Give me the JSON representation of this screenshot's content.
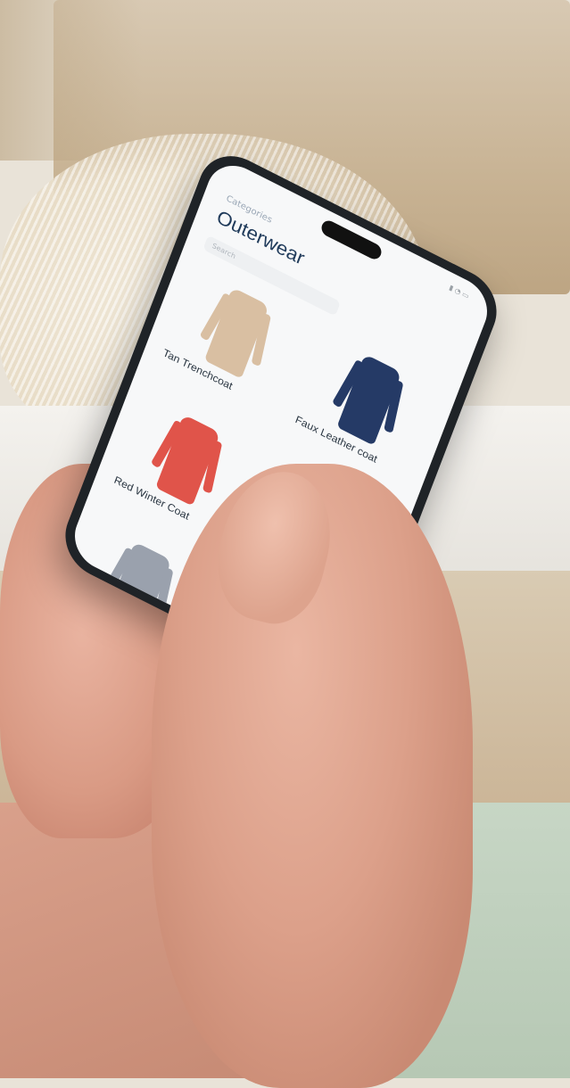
{
  "app": {
    "back_label": "Categories",
    "title": "Outerwear",
    "search_placeholder": "Search"
  },
  "products": [
    {
      "name": "Tan Trenchcoat",
      "color": "#d9bfa2"
    },
    {
      "name": "Faux Leather coat",
      "color": "#253a66"
    },
    {
      "name": "Red Winter Coat",
      "color": "#e0544a"
    },
    {
      "name": "",
      "color": "#d8d2cc"
    },
    {
      "name": "",
      "color": "#9aa1ad"
    },
    {
      "name": "",
      "color": "#d6d0c8"
    }
  ],
  "icons": {
    "status": [
      "signal-icon",
      "wifi-icon",
      "battery-icon"
    ]
  }
}
